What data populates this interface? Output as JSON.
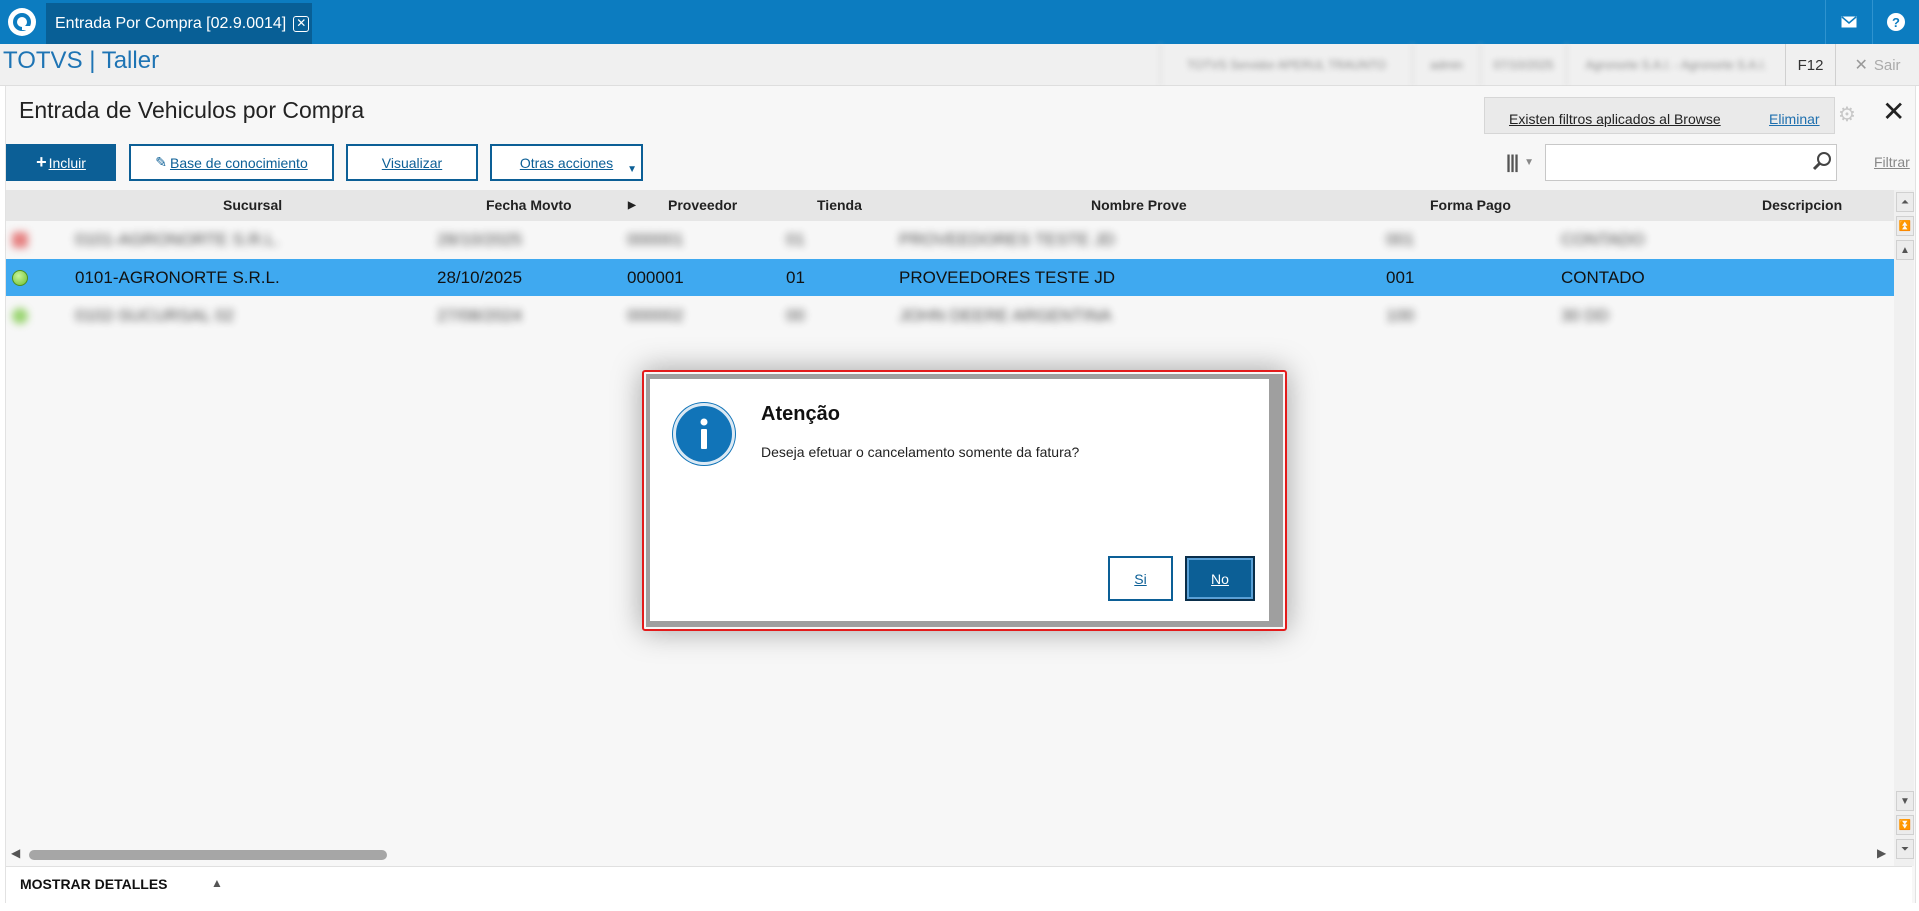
{
  "topbar": {
    "tab_title": "Entrada Por Compra [02.9.0014]",
    "tab_close": "✕"
  },
  "header": {
    "brand": "TOTVS | Taller",
    "f12": "F12",
    "sair": "Sair",
    "session_info": [
      "TOTVS Servidor APERUL TRAUNTO",
      "admin",
      "07/10/2025",
      "Agronorte S.A.I. - Agronorte S.A.I."
    ]
  },
  "page": {
    "title": "Entrada de Vehiculos por Compra",
    "filter_notice": "Existen filtros aplicados al Browse",
    "filter_remove": "Eliminar",
    "filtrar": "Filtrar",
    "search_placeholder": ""
  },
  "toolbar": {
    "incluir": "Incluir",
    "base_conocimiento": "Base de conocimiento",
    "visualizar": "Visualizar",
    "otras_acciones": "Otras acciones"
  },
  "grid": {
    "columns": [
      "Sucursal",
      "Fecha Movto",
      "Proveedor",
      "Tienda",
      "Nombre Prove",
      "Forma Pago",
      "Descripcion"
    ],
    "rows": [
      {
        "sucursal": "0101-AGRONORTE S.R.L.",
        "fecha": "28/10/2025",
        "proveedor": "000001",
        "tienda": "01",
        "nombre": "PROVEEDORES TESTE JD",
        "forma_pago": "001",
        "descripcion": "CONTADO",
        "status_color": "#e05a5a"
      },
      {
        "sucursal": "0101-AGRONORTE S.R.L.",
        "fecha": "28/10/2025",
        "proveedor": "000001",
        "tienda": "01",
        "nombre": "PROVEEDORES TESTE JD",
        "forma_pago": "001",
        "descripcion": "CONTADO",
        "status_color": "#7ac943"
      },
      {
        "sucursal": "0102-SUCURSAL 02",
        "fecha": "27/08/2024",
        "proveedor": "000002",
        "tienda": "00",
        "nombre": "JOHN DEERE ARGENTINA",
        "forma_pago": "100",
        "descripcion": "30 DD",
        "status_color": "#7ac943"
      }
    ]
  },
  "footer": {
    "details": "MOSTRAR DETALLES"
  },
  "dialog": {
    "title": "Atenção",
    "message": "Deseja efetuar o cancelamento somente da fatura?",
    "yes": "Si",
    "no": "No"
  },
  "colors": {
    "brand_blue": "#0c7cc0",
    "button_blue": "#0c5f96",
    "selected_row": "#3fa9f0",
    "highlight_red": "#e31b1b"
  }
}
